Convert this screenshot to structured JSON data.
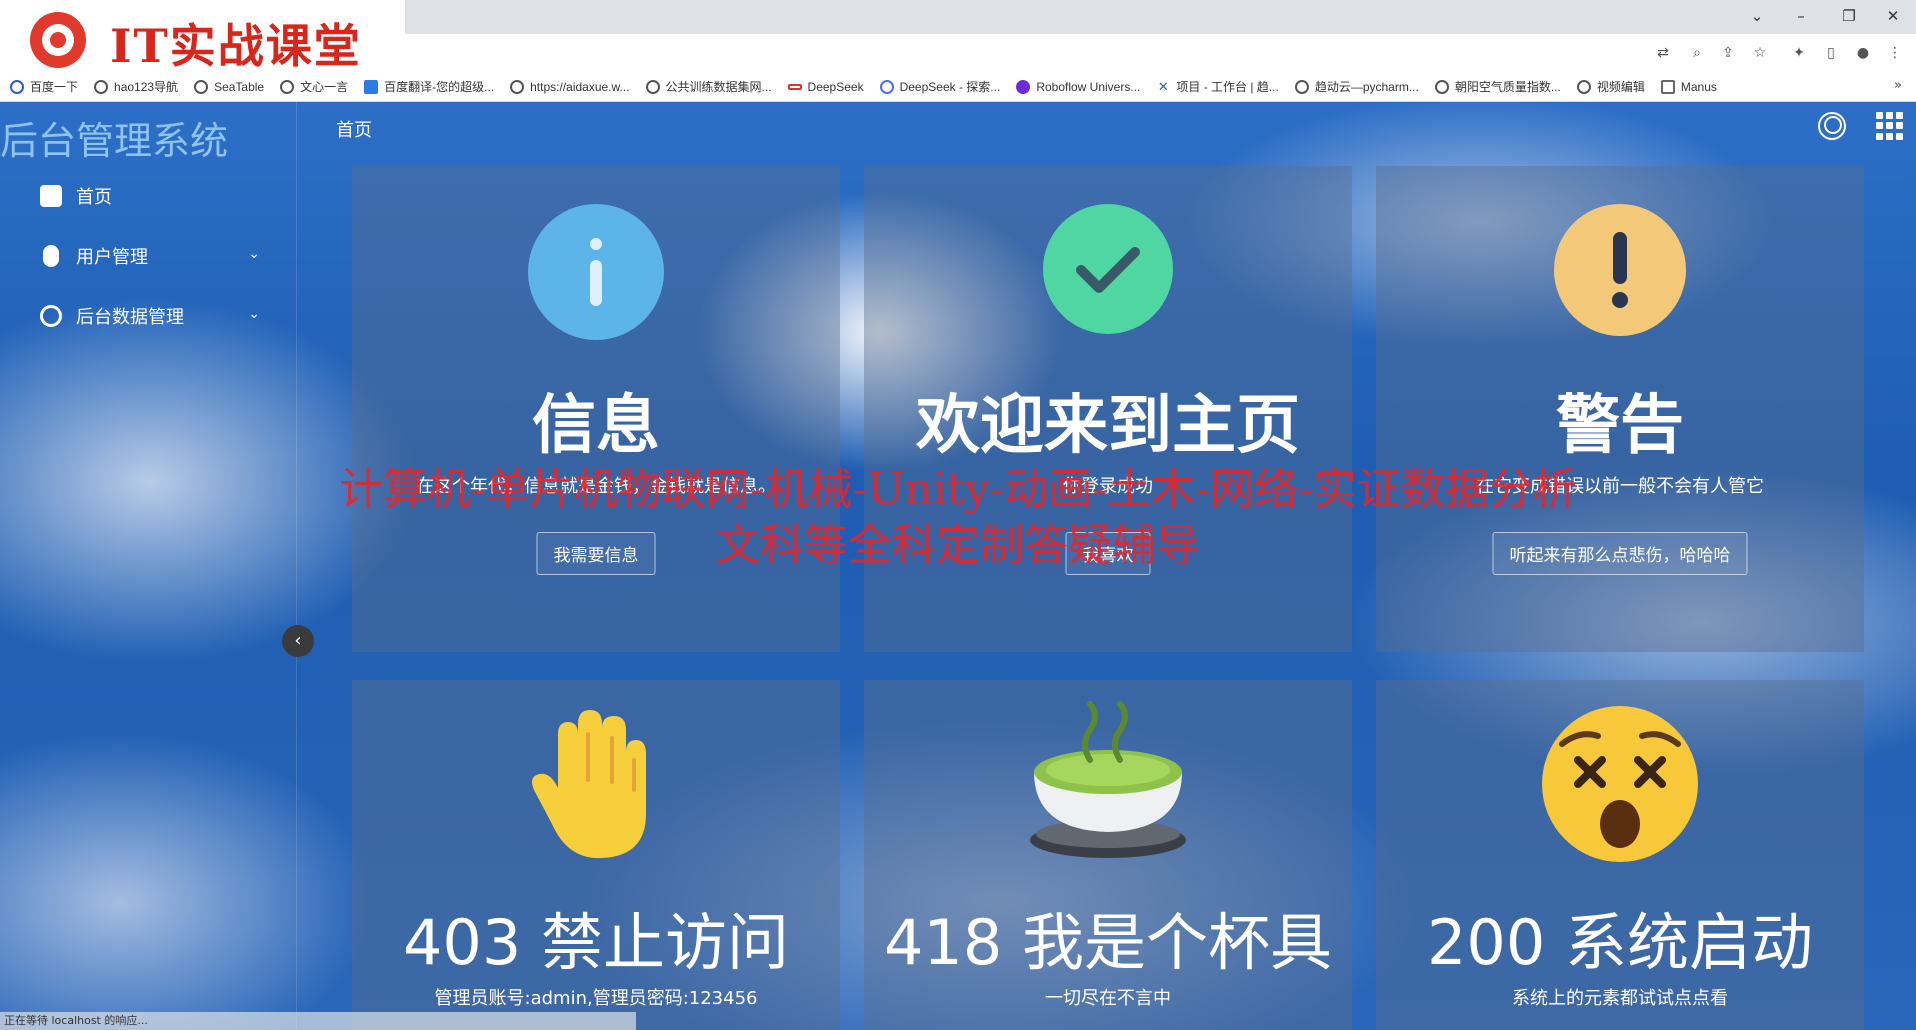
{
  "browser": {
    "bookmarks": [
      {
        "label": "百度一下"
      },
      {
        "label": "hao123导航"
      },
      {
        "label": "SeaTable"
      },
      {
        "label": "文心一言"
      },
      {
        "label": "百度翻译-您的超级..."
      },
      {
        "label": "https://aidaxue.w..."
      },
      {
        "label": "公共训练数据集网..."
      },
      {
        "label": "DeepSeek"
      },
      {
        "label": "DeepSeek - 探索..."
      },
      {
        "label": "Roboflow Univers..."
      },
      {
        "label": "项目 - 工作台 | 趋..."
      },
      {
        "label": "趋动云—pycharm..."
      },
      {
        "label": "朝阳空气质量指数..."
      },
      {
        "label": "视频编辑"
      },
      {
        "label": "Manus"
      }
    ],
    "more": "»",
    "status": "正在等待 localhost 的响应..."
  },
  "logo": {
    "text": "IT实战课堂"
  },
  "sidebar": {
    "brand": "后台管理系统",
    "items": [
      {
        "label": "首页"
      },
      {
        "label": "用户管理",
        "caret": "⌄"
      },
      {
        "label": "后台数据管理",
        "caret": "⌄"
      }
    ],
    "collapse": "‹"
  },
  "header": {
    "breadcrumb": "首页"
  },
  "cards": [
    {
      "title": "信息",
      "desc": "在这个年代，信息就是金钱，金钱就是信息。",
      "button": "我需要信息",
      "color": "#5db4e8",
      "icon": "info-icon"
    },
    {
      "title": "欢迎来到主页",
      "desc": "你登录成功",
      "button": "我喜欢",
      "color": "#4fd6a3",
      "icon": "check-icon"
    },
    {
      "title": "警告",
      "desc": "在它变成错误以前一般不会有人管它",
      "button": "听起来有那么点悲伤，哈哈哈",
      "color": "#f3c979",
      "icon": "exclamation-icon"
    }
  ],
  "stats": [
    {
      "title": "403 禁止访问",
      "desc": "管理员账号:admin,管理员密码:123456",
      "icon": "raised-hand-icon"
    },
    {
      "title": "418 我是个杯具",
      "desc": "一切尽在不言中",
      "icon": "tea-cup-icon"
    },
    {
      "title": "200 系统启动",
      "desc": "系统上的元素都试试点点看",
      "icon": "dizzy-face-icon"
    }
  ],
  "watermark": {
    "line1": "计算机-单片机物联网-机械-Unity-动画-土木-网络-实证数据分析",
    "line2": "文科等全科定制答疑辅导"
  }
}
